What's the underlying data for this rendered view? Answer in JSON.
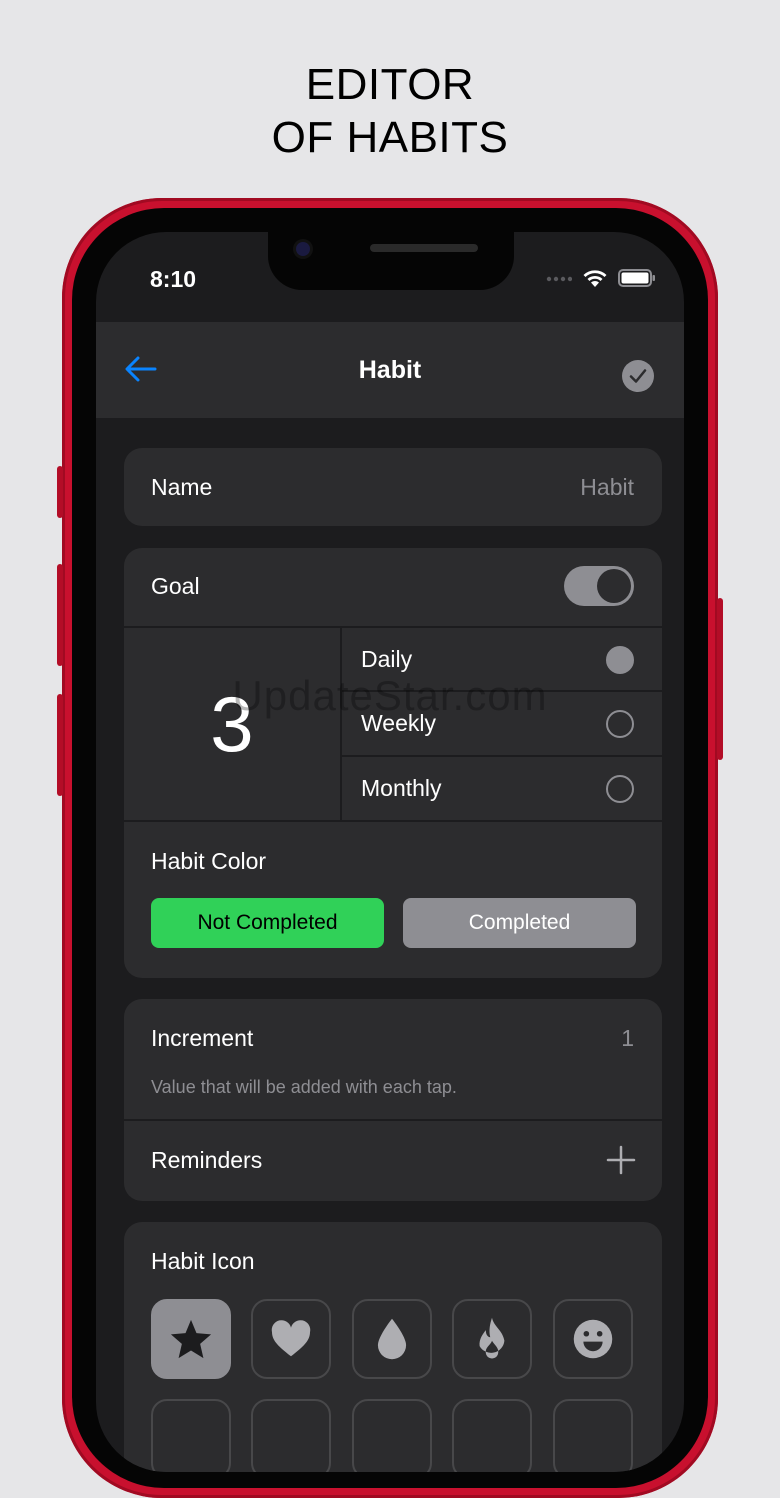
{
  "headline": {
    "line1": "EDITOR",
    "line2": "OF HABITS"
  },
  "status": {
    "time": "8:10"
  },
  "nav": {
    "title": "Habit"
  },
  "name": {
    "label": "Name",
    "placeholder": "Habit"
  },
  "goal": {
    "label": "Goal",
    "enabled": true,
    "value": "3",
    "periods": [
      {
        "label": "Daily",
        "selected": true
      },
      {
        "label": "Weekly",
        "selected": false
      },
      {
        "label": "Monthly",
        "selected": false
      }
    ]
  },
  "habit_color": {
    "label": "Habit Color",
    "not_completed": {
      "label": "Not Completed",
      "color": "#30d158"
    },
    "completed": {
      "label": "Completed",
      "color": "#8e8e93"
    }
  },
  "increment": {
    "label": "Increment",
    "value": "1",
    "hint": "Value that will be added with each tap."
  },
  "reminders": {
    "label": "Reminders"
  },
  "habit_icon": {
    "label": "Habit Icon",
    "icons": [
      "star-icon",
      "heart-icon",
      "drop-icon",
      "flame-icon",
      "smiley-icon"
    ],
    "selected": 0
  },
  "watermark": "UpdateStar.com",
  "colors": {
    "accent": "#0a84ff",
    "background": "#1c1c1e",
    "card": "#2c2c2e",
    "phone": "#c8102e"
  }
}
